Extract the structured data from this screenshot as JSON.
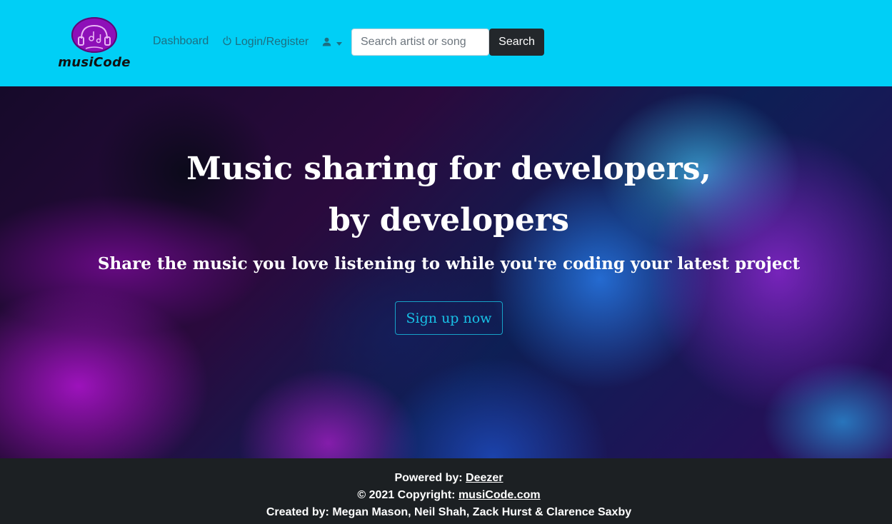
{
  "brand": {
    "name": "musiCode",
    "color": "#8e10b8"
  },
  "nav": {
    "background": "#00cff6",
    "dashboard_label": "Dashboard",
    "login_label": "Login/Register",
    "login_icon": "power-icon",
    "user_icon": "user-icon"
  },
  "search": {
    "placeholder": "Search artist or song",
    "value": "",
    "button_label": "Search"
  },
  "hero": {
    "title_line1": "Music sharing for developers,",
    "title_line2": "by developers",
    "subtitle": "Share the music you love listening to while you're coding your latest project",
    "cta_label": "Sign up now",
    "cta_color": "#18c1e6"
  },
  "footer": {
    "powered_prefix": "Powered by: ",
    "powered_link": "Deezer",
    "copyright_prefix": "© 2021 Copyright: ",
    "copyright_link": "musiCode.com",
    "credits": "Created by: Megan Mason, Neil Shah, Zack Hurst & Clarence Saxby"
  }
}
